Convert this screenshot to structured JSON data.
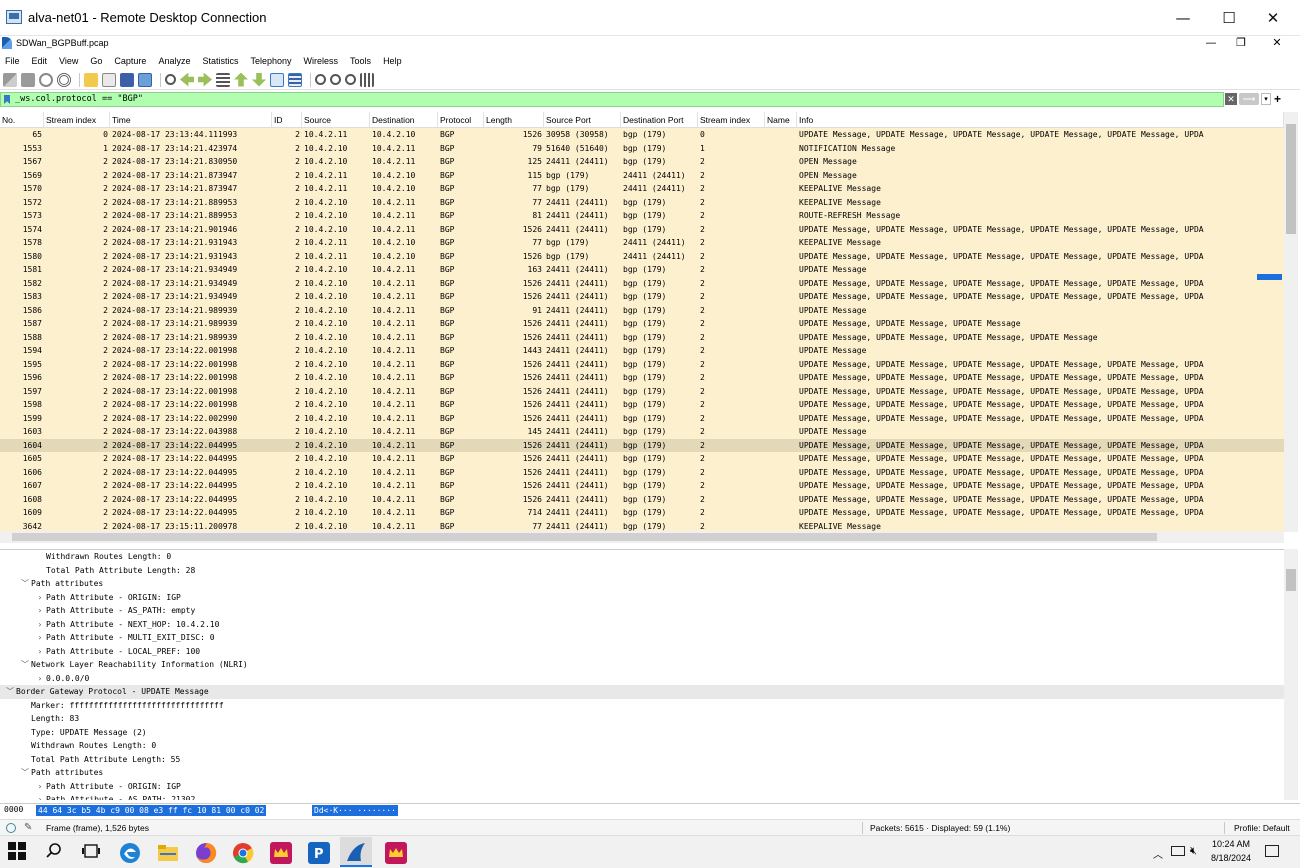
{
  "rdp": {
    "title": "alva-net01 - Remote Desktop Connection",
    "minimize_glyph": "—",
    "maximize_glyph": "☐",
    "close_glyph": "✕"
  },
  "wireshark": {
    "title": "SDWan_BGPBuff.pcap",
    "minimize_glyph": "—",
    "restore_glyph": "❐",
    "close_glyph": "✕"
  },
  "menu": [
    "File",
    "Edit",
    "View",
    "Go",
    "Capture",
    "Analyze",
    "Statistics",
    "Telephony",
    "Wireless",
    "Tools",
    "Help"
  ],
  "filter": {
    "value": "_ws.col.protocol == \"BGP\"",
    "clear_glyph": "✕",
    "apply_glyph": "⟶",
    "dropdown_glyph": "▾",
    "add_glyph": "+"
  },
  "columns": [
    "No.",
    "Stream index",
    "Time",
    "ID",
    "Source",
    "Destination",
    "Protocol",
    "Length",
    "Source Port",
    "Destination Port",
    "Stream index",
    "Name",
    "Info"
  ],
  "packets": [
    {
      "no": "65",
      "stream": "0",
      "time": "2024-08-17 23:13:44.111993",
      "id": "2",
      "src": "10.4.2.11",
      "dst": "10.4.2.10",
      "proto": "BGP",
      "len": "1526",
      "sport": "30958 (30958)",
      "dport": "bgp (179)",
      "stream2": "0",
      "name": "",
      "info": "UPDATE Message, UPDATE Message, UPDATE Message, UPDATE Message, UPDATE Message, UPDA"
    },
    {
      "no": "1553",
      "stream": "1",
      "time": "2024-08-17 23:14:21.423974",
      "id": "2",
      "src": "10.4.2.10",
      "dst": "10.4.2.11",
      "proto": "BGP",
      "len": "79",
      "sport": "51640 (51640)",
      "dport": "bgp (179)",
      "stream2": "1",
      "name": "",
      "info": "NOTIFICATION Message"
    },
    {
      "no": "1567",
      "stream": "2",
      "time": "2024-08-17 23:14:21.830950",
      "id": "2",
      "src": "10.4.2.10",
      "dst": "10.4.2.11",
      "proto": "BGP",
      "len": "125",
      "sport": "24411 (24411)",
      "dport": "bgp (179)",
      "stream2": "2",
      "name": "",
      "info": "OPEN Message"
    },
    {
      "no": "1569",
      "stream": "2",
      "time": "2024-08-17 23:14:21.873947",
      "id": "2",
      "src": "10.4.2.11",
      "dst": "10.4.2.10",
      "proto": "BGP",
      "len": "115",
      "sport": "bgp (179)",
      "dport": "24411 (24411)",
      "stream2": "2",
      "name": "",
      "info": "OPEN Message"
    },
    {
      "no": "1570",
      "stream": "2",
      "time": "2024-08-17 23:14:21.873947",
      "id": "2",
      "src": "10.4.2.11",
      "dst": "10.4.2.10",
      "proto": "BGP",
      "len": "77",
      "sport": "bgp (179)",
      "dport": "24411 (24411)",
      "stream2": "2",
      "name": "",
      "info": "KEEPALIVE Message"
    },
    {
      "no": "1572",
      "stream": "2",
      "time": "2024-08-17 23:14:21.889953",
      "id": "2",
      "src": "10.4.2.10",
      "dst": "10.4.2.11",
      "proto": "BGP",
      "len": "77",
      "sport": "24411 (24411)",
      "dport": "bgp (179)",
      "stream2": "2",
      "name": "",
      "info": "KEEPALIVE Message"
    },
    {
      "no": "1573",
      "stream": "2",
      "time": "2024-08-17 23:14:21.889953",
      "id": "2",
      "src": "10.4.2.10",
      "dst": "10.4.2.11",
      "proto": "BGP",
      "len": "81",
      "sport": "24411 (24411)",
      "dport": "bgp (179)",
      "stream2": "2",
      "name": "",
      "info": "ROUTE-REFRESH Message"
    },
    {
      "no": "1574",
      "stream": "2",
      "time": "2024-08-17 23:14:21.901946",
      "id": "2",
      "src": "10.4.2.10",
      "dst": "10.4.2.11",
      "proto": "BGP",
      "len": "1526",
      "sport": "24411 (24411)",
      "dport": "bgp (179)",
      "stream2": "2",
      "name": "",
      "info": "UPDATE Message, UPDATE Message, UPDATE Message, UPDATE Message, UPDATE Message, UPDA"
    },
    {
      "no": "1578",
      "stream": "2",
      "time": "2024-08-17 23:14:21.931943",
      "id": "2",
      "src": "10.4.2.11",
      "dst": "10.4.2.10",
      "proto": "BGP",
      "len": "77",
      "sport": "bgp (179)",
      "dport": "24411 (24411)",
      "stream2": "2",
      "name": "",
      "info": "KEEPALIVE Message"
    },
    {
      "no": "1580",
      "stream": "2",
      "time": "2024-08-17 23:14:21.931943",
      "id": "2",
      "src": "10.4.2.11",
      "dst": "10.4.2.10",
      "proto": "BGP",
      "len": "1526",
      "sport": "bgp (179)",
      "dport": "24411 (24411)",
      "stream2": "2",
      "name": "",
      "info": "UPDATE Message, UPDATE Message, UPDATE Message, UPDATE Message, UPDATE Message, UPDA"
    },
    {
      "no": "1581",
      "stream": "2",
      "time": "2024-08-17 23:14:21.934949",
      "id": "2",
      "src": "10.4.2.10",
      "dst": "10.4.2.11",
      "proto": "BGP",
      "len": "163",
      "sport": "24411 (24411)",
      "dport": "bgp (179)",
      "stream2": "2",
      "name": "",
      "info": "UPDATE Message"
    },
    {
      "no": "1582",
      "stream": "2",
      "time": "2024-08-17 23:14:21.934949",
      "id": "2",
      "src": "10.4.2.10",
      "dst": "10.4.2.11",
      "proto": "BGP",
      "len": "1526",
      "sport": "24411 (24411)",
      "dport": "bgp (179)",
      "stream2": "2",
      "name": "",
      "info": "UPDATE Message, UPDATE Message, UPDATE Message, UPDATE Message, UPDATE Message, UPDA"
    },
    {
      "no": "1583",
      "stream": "2",
      "time": "2024-08-17 23:14:21.934949",
      "id": "2",
      "src": "10.4.2.10",
      "dst": "10.4.2.11",
      "proto": "BGP",
      "len": "1526",
      "sport": "24411 (24411)",
      "dport": "bgp (179)",
      "stream2": "2",
      "name": "",
      "info": "UPDATE Message, UPDATE Message, UPDATE Message, UPDATE Message, UPDATE Message, UPDA"
    },
    {
      "no": "1586",
      "stream": "2",
      "time": "2024-08-17 23:14:21.989939",
      "id": "2",
      "src": "10.4.2.10",
      "dst": "10.4.2.11",
      "proto": "BGP",
      "len": "91",
      "sport": "24411 (24411)",
      "dport": "bgp (179)",
      "stream2": "2",
      "name": "",
      "info": "UPDATE Message"
    },
    {
      "no": "1587",
      "stream": "2",
      "time": "2024-08-17 23:14:21.989939",
      "id": "2",
      "src": "10.4.2.10",
      "dst": "10.4.2.11",
      "proto": "BGP",
      "len": "1526",
      "sport": "24411 (24411)",
      "dport": "bgp (179)",
      "stream2": "2",
      "name": "",
      "info": "UPDATE Message, UPDATE Message, UPDATE Message"
    },
    {
      "no": "1588",
      "stream": "2",
      "time": "2024-08-17 23:14:21.989939",
      "id": "2",
      "src": "10.4.2.10",
      "dst": "10.4.2.11",
      "proto": "BGP",
      "len": "1526",
      "sport": "24411 (24411)",
      "dport": "bgp (179)",
      "stream2": "2",
      "name": "",
      "info": "UPDATE Message, UPDATE Message, UPDATE Message, UPDATE Message"
    },
    {
      "no": "1594",
      "stream": "2",
      "time": "2024-08-17 23:14:22.001998",
      "id": "2",
      "src": "10.4.2.10",
      "dst": "10.4.2.11",
      "proto": "BGP",
      "len": "1443",
      "sport": "24411 (24411)",
      "dport": "bgp (179)",
      "stream2": "2",
      "name": "",
      "info": "UPDATE Message"
    },
    {
      "no": "1595",
      "stream": "2",
      "time": "2024-08-17 23:14:22.001998",
      "id": "2",
      "src": "10.4.2.10",
      "dst": "10.4.2.11",
      "proto": "BGP",
      "len": "1526",
      "sport": "24411 (24411)",
      "dport": "bgp (179)",
      "stream2": "2",
      "name": "",
      "info": "UPDATE Message, UPDATE Message, UPDATE Message, UPDATE Message, UPDATE Message, UPDA"
    },
    {
      "no": "1596",
      "stream": "2",
      "time": "2024-08-17 23:14:22.001998",
      "id": "2",
      "src": "10.4.2.10",
      "dst": "10.4.2.11",
      "proto": "BGP",
      "len": "1526",
      "sport": "24411 (24411)",
      "dport": "bgp (179)",
      "stream2": "2",
      "name": "",
      "info": "UPDATE Message, UPDATE Message, UPDATE Message, UPDATE Message, UPDATE Message, UPDA"
    },
    {
      "no": "1597",
      "stream": "2",
      "time": "2024-08-17 23:14:22.001998",
      "id": "2",
      "src": "10.4.2.10",
      "dst": "10.4.2.11",
      "proto": "BGP",
      "len": "1526",
      "sport": "24411 (24411)",
      "dport": "bgp (179)",
      "stream2": "2",
      "name": "",
      "info": "UPDATE Message, UPDATE Message, UPDATE Message, UPDATE Message, UPDATE Message, UPDA"
    },
    {
      "no": "1598",
      "stream": "2",
      "time": "2024-08-17 23:14:22.001998",
      "id": "2",
      "src": "10.4.2.10",
      "dst": "10.4.2.11",
      "proto": "BGP",
      "len": "1526",
      "sport": "24411 (24411)",
      "dport": "bgp (179)",
      "stream2": "2",
      "name": "",
      "info": "UPDATE Message, UPDATE Message, UPDATE Message, UPDATE Message, UPDATE Message, UPDA"
    },
    {
      "no": "1599",
      "stream": "2",
      "time": "2024-08-17 23:14:22.002990",
      "id": "2",
      "src": "10.4.2.10",
      "dst": "10.4.2.11",
      "proto": "BGP",
      "len": "1526",
      "sport": "24411 (24411)",
      "dport": "bgp (179)",
      "stream2": "2",
      "name": "",
      "info": "UPDATE Message, UPDATE Message, UPDATE Message, UPDATE Message, UPDATE Message, UPDA"
    },
    {
      "no": "1603",
      "stream": "2",
      "time": "2024-08-17 23:14:22.043988",
      "id": "2",
      "src": "10.4.2.10",
      "dst": "10.4.2.11",
      "proto": "BGP",
      "len": "145",
      "sport": "24411 (24411)",
      "dport": "bgp (179)",
      "stream2": "2",
      "name": "",
      "info": "UPDATE Message"
    },
    {
      "no": "1604",
      "stream": "2",
      "time": "2024-08-17 23:14:22.044995",
      "id": "2",
      "src": "10.4.2.10",
      "dst": "10.4.2.11",
      "proto": "BGP",
      "len": "1526",
      "sport": "24411 (24411)",
      "dport": "bgp (179)",
      "stream2": "2",
      "name": "",
      "info": "UPDATE Message, UPDATE Message, UPDATE Message, UPDATE Message, UPDATE Message, UPDA",
      "selected": true
    },
    {
      "no": "1605",
      "stream": "2",
      "time": "2024-08-17 23:14:22.044995",
      "id": "2",
      "src": "10.4.2.10",
      "dst": "10.4.2.11",
      "proto": "BGP",
      "len": "1526",
      "sport": "24411 (24411)",
      "dport": "bgp (179)",
      "stream2": "2",
      "name": "",
      "info": "UPDATE Message, UPDATE Message, UPDATE Message, UPDATE Message, UPDATE Message, UPDA"
    },
    {
      "no": "1606",
      "stream": "2",
      "time": "2024-08-17 23:14:22.044995",
      "id": "2",
      "src": "10.4.2.10",
      "dst": "10.4.2.11",
      "proto": "BGP",
      "len": "1526",
      "sport": "24411 (24411)",
      "dport": "bgp (179)",
      "stream2": "2",
      "name": "",
      "info": "UPDATE Message, UPDATE Message, UPDATE Message, UPDATE Message, UPDATE Message, UPDA"
    },
    {
      "no": "1607",
      "stream": "2",
      "time": "2024-08-17 23:14:22.044995",
      "id": "2",
      "src": "10.4.2.10",
      "dst": "10.4.2.11",
      "proto": "BGP",
      "len": "1526",
      "sport": "24411 (24411)",
      "dport": "bgp (179)",
      "stream2": "2",
      "name": "",
      "info": "UPDATE Message, UPDATE Message, UPDATE Message, UPDATE Message, UPDATE Message, UPDA"
    },
    {
      "no": "1608",
      "stream": "2",
      "time": "2024-08-17 23:14:22.044995",
      "id": "2",
      "src": "10.4.2.10",
      "dst": "10.4.2.11",
      "proto": "BGP",
      "len": "1526",
      "sport": "24411 (24411)",
      "dport": "bgp (179)",
      "stream2": "2",
      "name": "",
      "info": "UPDATE Message, UPDATE Message, UPDATE Message, UPDATE Message, UPDATE Message, UPDA"
    },
    {
      "no": "1609",
      "stream": "2",
      "time": "2024-08-17 23:14:22.044995",
      "id": "2",
      "src": "10.4.2.10",
      "dst": "10.4.2.11",
      "proto": "BGP",
      "len": "714",
      "sport": "24411 (24411)",
      "dport": "bgp (179)",
      "stream2": "2",
      "name": "",
      "info": "UPDATE Message, UPDATE Message, UPDATE Message, UPDATE Message, UPDATE Message, UPDA"
    },
    {
      "no": "3642",
      "stream": "2",
      "time": "2024-08-17 23:15:11.200978",
      "id": "2",
      "src": "10.4.2.10",
      "dst": "10.4.2.11",
      "proto": "BGP",
      "len": "77",
      "sport": "24411 (24411)",
      "dport": "bgp (179)",
      "stream2": "2",
      "name": "",
      "info": "KEEPALIVE Message"
    }
  ],
  "details": [
    {
      "indent": 2,
      "arrow": "",
      "text": "Withdrawn Routes Length: 0"
    },
    {
      "indent": 2,
      "arrow": "",
      "text": "Total Path Attribute Length: 28"
    },
    {
      "indent": 1,
      "arrow": "﹀",
      "text": "Path attributes"
    },
    {
      "indent": 2,
      "arrow": "›",
      "text": "Path Attribute - ORIGIN: IGP"
    },
    {
      "indent": 2,
      "arrow": "›",
      "text": "Path Attribute - AS_PATH: empty"
    },
    {
      "indent": 2,
      "arrow": "›",
      "text": "Path Attribute - NEXT_HOP: 10.4.2.10"
    },
    {
      "indent": 2,
      "arrow": "›",
      "text": "Path Attribute - MULTI_EXIT_DISC: 0"
    },
    {
      "indent": 2,
      "arrow": "›",
      "text": "Path Attribute - LOCAL_PREF: 100"
    },
    {
      "indent": 1,
      "arrow": "﹀",
      "text": "Network Layer Reachability Information (NLRI)"
    },
    {
      "indent": 2,
      "arrow": "›",
      "text": "0.0.0.0/0"
    },
    {
      "indent": 0,
      "arrow": "﹀",
      "text": "Border Gateway Protocol - UPDATE Message",
      "hl": true
    },
    {
      "indent": 1,
      "arrow": "",
      "text": "Marker: ffffffffffffffffffffffffffffffff"
    },
    {
      "indent": 1,
      "arrow": "",
      "text": "Length: 83"
    },
    {
      "indent": 1,
      "arrow": "",
      "text": "Type: UPDATE Message (2)"
    },
    {
      "indent": 1,
      "arrow": "",
      "text": "Withdrawn Routes Length: 0"
    },
    {
      "indent": 1,
      "arrow": "",
      "text": "Total Path Attribute Length: 55"
    },
    {
      "indent": 1,
      "arrow": "﹀",
      "text": "Path attributes"
    },
    {
      "indent": 2,
      "arrow": "›",
      "text": "Path Attribute - ORIGIN: IGP"
    },
    {
      "indent": 2,
      "arrow": "›",
      "text": "Path Attribute - AS_PATH: 21302"
    }
  ],
  "bytes": {
    "offset": "0000",
    "hex": "44 64 3c b5 4b c9 00 08  e3 ff fc 10 81 00 c0 02",
    "ascii": "Dd<·K··· ········"
  },
  "status": {
    "frame": "Frame (frame), 1,526 bytes",
    "packets": "Packets: 5615 · Displayed: 59 (1.1%)",
    "profile": "Profile: Default"
  },
  "taskbar": {
    "time": "10:24 AM",
    "date": "8/18/2024"
  },
  "colors": {
    "row_bg": "#fdf0cf",
    "row_selected_bg": "#e3d8b8",
    "filter_ok_bg": "#afffaf",
    "selection_blue": "#1c6fdc"
  }
}
